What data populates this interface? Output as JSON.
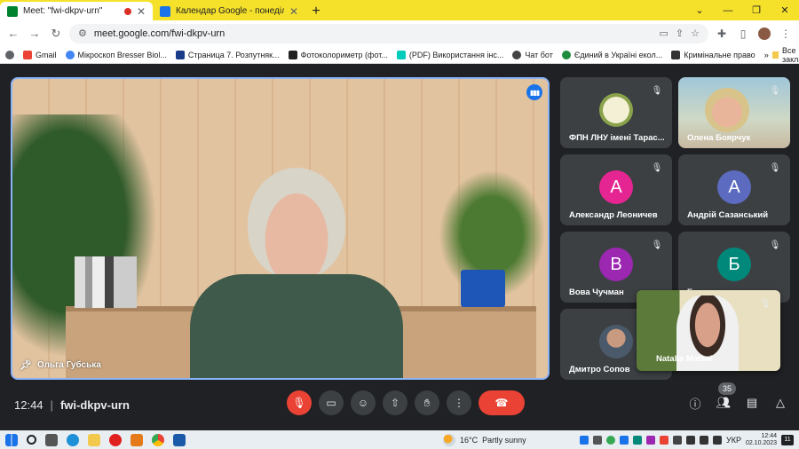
{
  "browser": {
    "tabs": [
      {
        "title": "Meet: \"fwi-dkpv-urn\"",
        "favicon_color": "#00832d",
        "recording": true,
        "active": true
      },
      {
        "title": "Календар Google - понеділок, 2 жовт",
        "favicon_color": "#1a73e8",
        "active": false
      }
    ],
    "new_tab": "+",
    "window_controls": {
      "minimize": "—",
      "maximize": "❐",
      "close": "✕",
      "collapse": "⌄"
    },
    "nav": {
      "back": "←",
      "forward": "→",
      "reload": "↻"
    },
    "url": "meet.google.com/fwi-dkpv-urn",
    "toolbar_icons": [
      "cast-icon",
      "share-icon",
      "star-icon",
      "extensions-icon",
      "sidebar-icon",
      "profile-icon",
      "menu-icon"
    ]
  },
  "bookmarks": {
    "items": [
      {
        "label": "Gmail",
        "color": "#ea4335"
      },
      {
        "label": "Мікроскоп Bresser Biol...",
        "color": "#4285f4"
      },
      {
        "label": "Страница 7. Розпутняк...",
        "color": "#1a3a8a"
      },
      {
        "label": "Фотоколориметр (фот...",
        "color": "#222"
      },
      {
        "label": "(PDF) Використання інс...",
        "color": "#00ccbb"
      },
      {
        "label": "Чат бот",
        "color": "#444"
      },
      {
        "label": "Єдиний в Україні екол...",
        "color": "#1e8e3e"
      },
      {
        "label": "Кримінальне право",
        "color": "#333"
      }
    ],
    "more": "»",
    "all_bookmarks": "Все закладки"
  },
  "meet": {
    "main_speaker": {
      "name": "Ольга Губська"
    },
    "participants": [
      {
        "name": "ФПН ЛНУ імені Тарас...",
        "type": "photo-logo"
      },
      {
        "name": "Олена Боярчук",
        "type": "photo"
      },
      {
        "name": "Александр Леоничев",
        "initial": "А",
        "color": "#e52592"
      },
      {
        "name": "Андрій Сазанський",
        "initial": "А",
        "color": "#5c6bc0"
      },
      {
        "name": "Вова Чучман",
        "initial": "В",
        "color": "#9c27b0"
      },
      {
        "name": "Богдан",
        "initial": "Б",
        "color": "#00897b"
      },
      {
        "name": "Дмитро Сопов",
        "type": "photo-small"
      }
    ],
    "self_view": {
      "name": "Natalia Matsai"
    },
    "time": "12:44",
    "separator": "|",
    "meeting_code": "fwi-dkpv-urn",
    "participant_count": "35",
    "controls": [
      "mic-off",
      "camera",
      "emoji",
      "present",
      "raise-hand",
      "more",
      "leave"
    ]
  },
  "taskbar": {
    "weather": {
      "temp": "16°C",
      "condition": "Partly sunny"
    },
    "language": "УКР",
    "time": "12:44",
    "date": "02.10.2023",
    "notifications": "11"
  }
}
